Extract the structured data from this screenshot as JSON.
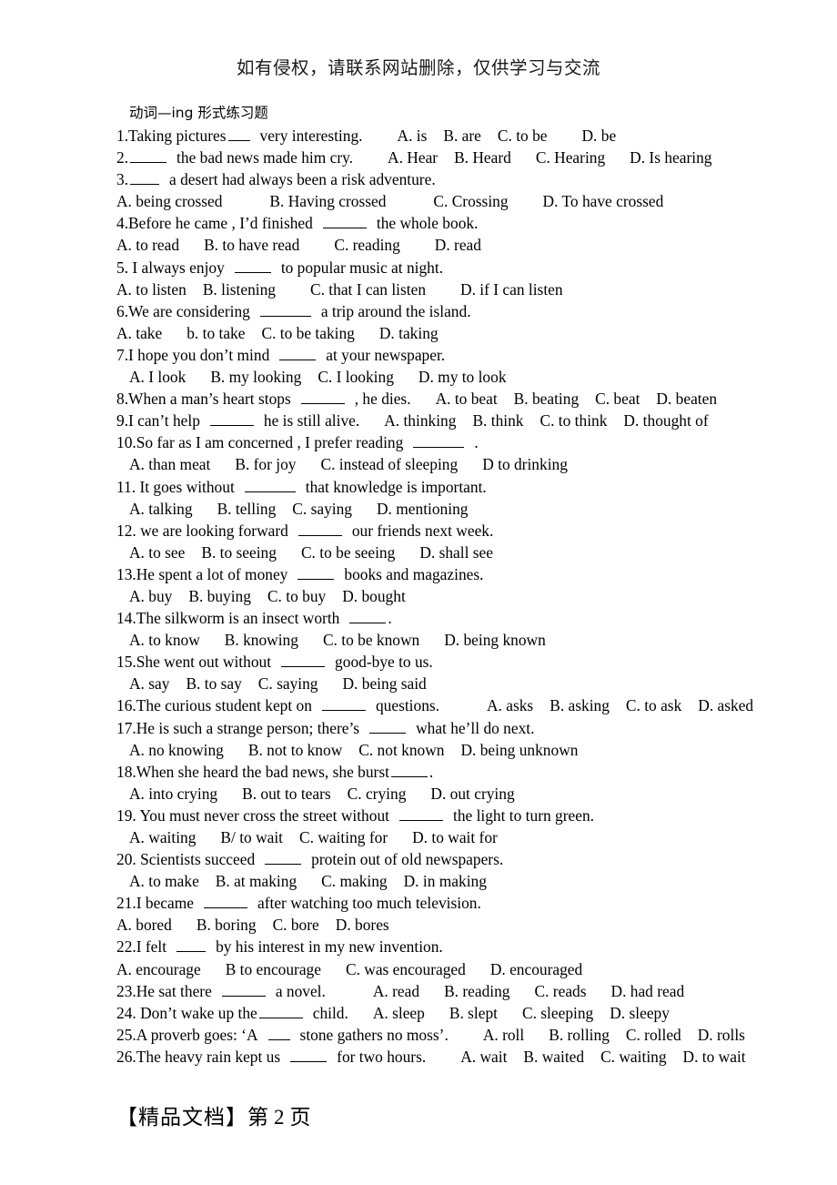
{
  "document": {
    "notice_header": "如有侵权，请联系网站删除，仅供学习与交流",
    "title": "动词—ing 形式练习题",
    "footer_label": "【精品文档】第",
    "footer_page": "2",
    "footer_unit": "页"
  },
  "questions": [
    {
      "number": "1.",
      "stem_before": "Taking pictures",
      "stem_after": "very interesting.",
      "options_inline": [
        "A. is",
        "B. are",
        "C. to be",
        "D. be"
      ],
      "layout": "inline"
    },
    {
      "number": "2.",
      "stem_before": "",
      "stem_after": "the bad news made him cry.",
      "options_inline": [
        "A. Hear",
        "B. Heard",
        "C. Hearing",
        "D. Is hearing"
      ],
      "layout": "inline"
    },
    {
      "number": "3.",
      "stem_before": "",
      "stem_after": "a desert had always been a risk adventure.",
      "options": [
        "A. being crossed",
        "B. Having crossed",
        "C. Crossing",
        "D. To have crossed"
      ],
      "layout": "two-line",
      "options_indent": false
    },
    {
      "number": "4.",
      "stem_before": "Before he came , I’d finished",
      "stem_after": "the whole book.",
      "options": [
        "A. to read",
        "B. to have read",
        "C. reading",
        "D. read"
      ],
      "layout": "two-line",
      "options_indent": false
    },
    {
      "number": "5.",
      "stem_before": " I always enjoy",
      "stem_after": "to popular music at night.",
      "options": [
        "A. to listen",
        "B. listening",
        "C. that I can listen",
        "D. if I can listen"
      ],
      "layout": "two-line",
      "options_indent": false
    },
    {
      "number": "6.",
      "stem_before": "We are considering",
      "stem_after": "a trip around the island.",
      "options": [
        "A. take",
        "b. to take",
        "C. to be taking",
        "D. taking"
      ],
      "layout": "two-line",
      "options_indent": false
    },
    {
      "number": "7.",
      "stem_before": "I hope you don’t mind",
      "stem_after": "at your newspaper.",
      "options": [
        "A. I look",
        "B. my looking",
        "C. I looking",
        "D. my to look"
      ],
      "layout": "two-line",
      "options_indent": true
    },
    {
      "number": "8.",
      "stem_before": "When a man’s heart stops",
      "stem_after": ", he dies.",
      "options_inline": [
        "A. to beat",
        "B. beating",
        "C. beat",
        "D. beaten"
      ],
      "layout": "inline"
    },
    {
      "number": "9.",
      "stem_before": "I can’t help",
      "stem_after": "he is still alive.",
      "options_inline": [
        "A. thinking",
        "B. think",
        "C. to think",
        "D. thought of"
      ],
      "layout": "inline"
    },
    {
      "number": "10.",
      "stem_before": "So far as I am concerned , I prefer reading",
      "stem_after": ".",
      "options": [
        "A. than meat",
        "B. for joy",
        "C.   instead of sleeping",
        "D to drinking"
      ],
      "layout": "two-line",
      "options_indent": true
    },
    {
      "number": "11.",
      "stem_before": " It goes without",
      "stem_after": "that knowledge is important.",
      "options": [
        "A. talking",
        "B. telling",
        "C. saying",
        "D. mentioning"
      ],
      "layout": "two-line",
      "options_indent": true
    },
    {
      "number": "12.",
      "stem_before": " we are looking forward",
      "stem_after": "our friends next week.",
      "options": [
        "A. to see",
        "B. to seeing",
        "C. to be seeing",
        "D. shall see"
      ],
      "layout": "two-line",
      "options_indent": true
    },
    {
      "number": "13.",
      "stem_before": "He spent a lot of money",
      "stem_after": "books and magazines.",
      "options": [
        "A. buy",
        "B. buying",
        "C. to buy",
        "D. bought"
      ],
      "layout": "two-line",
      "options_indent": true
    },
    {
      "number": "14.",
      "stem_before": "The silkworm is an insect worth",
      "stem_after": ".",
      "options": [
        "A. to know",
        "B. knowing",
        "C. to be known",
        "D. being known"
      ],
      "layout": "two-line",
      "options_indent": true
    },
    {
      "number": "15.",
      "stem_before": "She went out without",
      "stem_after": "good-bye to us.",
      "options": [
        "A. say",
        "B. to say",
        "C. saying",
        "D. being said"
      ],
      "layout": "two-line",
      "options_indent": true
    },
    {
      "number": "16.",
      "stem_before": "The curious student kept on",
      "stem_after": "questions.",
      "options_inline": [
        "A. asks",
        "B. asking",
        "C. to ask",
        "D. asked"
      ],
      "layout": "inline"
    },
    {
      "number": "17.",
      "stem_before": "He is such a strange person; there’s",
      "stem_after": "what he’ll do next.",
      "options": [
        "A. no knowing",
        "B. not to know",
        "C. not known",
        "D. being unknown"
      ],
      "layout": "two-line",
      "options_indent": true
    },
    {
      "number": "18.",
      "stem_before": "When she heard the bad news, she burst",
      "stem_after": ".",
      "options": [
        "A. into crying",
        "B. out to tears",
        "C. crying",
        "D. out crying"
      ],
      "layout": "two-line",
      "options_indent": true
    },
    {
      "number": "19.",
      "stem_before": " You must never cross the street without",
      "stem_after": "the light to turn green.",
      "options": [
        "A. waiting",
        "B/ to wait",
        "C. waiting for",
        "D. to wait for"
      ],
      "layout": "two-line",
      "options_indent": true
    },
    {
      "number": "20.",
      "stem_before": " Scientists succeed",
      "stem_after": "protein out of old newspapers.",
      "options": [
        "A. to make",
        "B. at making",
        "C. making",
        "D. in making"
      ],
      "layout": "two-line",
      "options_indent": true
    },
    {
      "number": "21.",
      "stem_before": "I became",
      "stem_after": "after watching too much television.",
      "options": [
        "A. bored",
        "B. boring",
        "C. bore",
        "D. bores"
      ],
      "layout": "two-line",
      "options_indent": false
    },
    {
      "number": "22.",
      "stem_before": "I felt",
      "stem_after": "by his interest in my new invention.",
      "options": [
        "A. encourage",
        "B to encourage",
        "C. was encouraged",
        "D. encouraged"
      ],
      "layout": "two-line",
      "options_indent": false
    },
    {
      "number": "23.",
      "stem_before": "He sat there",
      "stem_after": "a novel.",
      "options_inline": [
        "A. read",
        "B. reading",
        "C. reads",
        "D. had read"
      ],
      "layout": "inline"
    },
    {
      "number": "24.",
      "stem_before": " Don’t wake up the",
      "stem_after": "child.",
      "options_inline": [
        "A. sleep",
        "B. slept",
        "C. sleeping",
        "D. sleepy"
      ],
      "layout": "inline"
    },
    {
      "number": "25.",
      "stem_before": "A proverb goes: ‘A",
      "stem_after": "stone gathers no moss’.",
      "options_inline": [
        "A. roll",
        "B. rolling",
        "C. rolled",
        "D. rolls"
      ],
      "layout": "inline"
    },
    {
      "number": "26.",
      "stem_before": "The heavy rain kept us",
      "stem_after": "for two hours.",
      "options_inline": [
        "A. wait",
        "B. waited",
        "C. waiting",
        "D. to wait"
      ],
      "layout": "inline"
    }
  ]
}
